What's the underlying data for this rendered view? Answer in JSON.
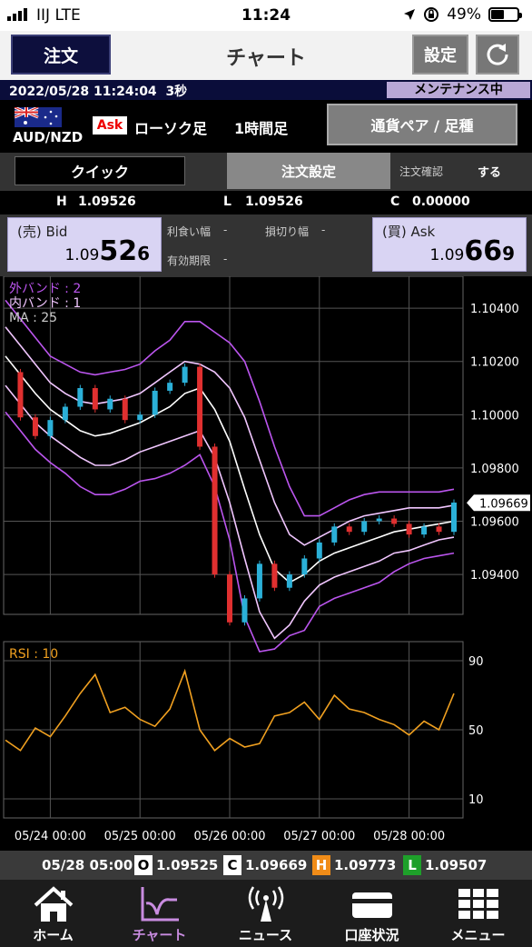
{
  "status_bar": {
    "carrier": "IIJ  LTE",
    "time": "11:24",
    "battery": "49%",
    "battery_level": 0.49,
    "icons": [
      "signal-bars-icon",
      "location-arrow-icon",
      "rotation-lock-icon",
      "battery-icon"
    ]
  },
  "header": {
    "order_button": "注文",
    "title": "チャート",
    "settings_button": "設定",
    "refresh_icon": "refresh-icon"
  },
  "info_bar": {
    "datetime": "2022/05/28 11:24:04",
    "interval": "3秒",
    "maintenance": "メンテナンス中"
  },
  "pair": {
    "name": "AUD/NZD",
    "flag_icon": "australia-flag-icon",
    "side": "Ask",
    "candle_type": "ローソク足",
    "timeframe": "1時間足",
    "pair_button": "通貨ペア / 足種"
  },
  "order_row": {
    "quick_button": "クイック",
    "order_settings": "注文設定",
    "confirm_label": "注文確認",
    "confirm_value": "する"
  },
  "hlc": {
    "h_label": "H",
    "h_value": "1.09526",
    "l_label": "L",
    "l_value": "1.09526",
    "c_label": "C",
    "c_value": "0.00000"
  },
  "bid": {
    "label": "(売) Bid",
    "prefix": "1.09",
    "big": "52",
    "tail": "6"
  },
  "ask": {
    "label": "(買) Ask",
    "prefix": "1.09",
    "big": "66",
    "tail": "9"
  },
  "order_fields": {
    "take_profit_label": "利食い幅",
    "take_profit_value": "-",
    "stop_loss_label": "損切り幅",
    "stop_loss_value": "-",
    "expiry_label": "有効期限",
    "expiry_value": "-"
  },
  "chart_data": [
    {
      "type": "line",
      "subtype": "candlestick",
      "pair": "AUD/NZD",
      "timeframe": "1時間足",
      "indicator_labels": [
        "外バンド : 2",
        "内バンド : 1",
        "MA : 25"
      ],
      "y_ticks": [
        "1.10400",
        "1.10200",
        "1.10000",
        "1.09800",
        "1.09600",
        "1.09400"
      ],
      "ylim": [
        1.0925,
        1.1052
      ],
      "current_price_label": "1.09669",
      "current_price": 1.09669,
      "x_ticks": [
        "05/24 00:00",
        "05/25 00:00",
        "05/26 00:00",
        "05/27 00:00",
        "05/28 00:00"
      ],
      "grid": true,
      "x": [
        0,
        4,
        8,
        12,
        16,
        20,
        24,
        28,
        32,
        36,
        40,
        44,
        48,
        52,
        56,
        60,
        64,
        68,
        72,
        76,
        80,
        84,
        88,
        92,
        96,
        100,
        104,
        108,
        112,
        116,
        120
      ],
      "series": [
        {
          "name": "MA : 25",
          "values": [
            1.1022,
            1.1015,
            1.1008,
            1.1002,
            1.0998,
            1.0994,
            1.0992,
            1.0993,
            1.0995,
            1.0997,
            1.1,
            1.1003,
            1.1008,
            1.101,
            1.1002,
            1.099,
            1.0972,
            1.0955,
            1.0942,
            1.0937,
            1.094,
            1.0945,
            1.0948,
            1.095,
            1.0952,
            1.0954,
            1.0956,
            1.0957,
            1.0958,
            1.0959,
            1.096
          ]
        },
        {
          "name": "内バンド : 1 (upper)",
          "values": [
            1.1033,
            1.1026,
            1.1019,
            1.1012,
            1.1008,
            1.1005,
            1.1004,
            1.1005,
            1.1006,
            1.1008,
            1.1012,
            1.1016,
            1.102,
            1.1019,
            1.1016,
            1.101,
            1.0999,
            1.0983,
            1.0967,
            1.0955,
            1.0951,
            1.0954,
            1.0957,
            1.096,
            1.0962,
            1.0963,
            1.0964,
            1.0965,
            1.0965,
            1.0965,
            1.0966
          ]
        },
        {
          "name": "内バンド : 1 (lower)",
          "values": [
            1.1011,
            1.1004,
            1.0997,
            1.0992,
            1.0988,
            1.0984,
            1.0981,
            1.0981,
            1.0983,
            1.0986,
            1.0988,
            1.099,
            1.0992,
            1.0994,
            1.0984,
            1.0967,
            1.0946,
            1.0926,
            1.0916,
            1.0921,
            1.093,
            1.0936,
            1.0939,
            1.0941,
            1.0943,
            1.0945,
            1.0948,
            1.0949,
            1.0951,
            1.0953,
            1.0954
          ]
        },
        {
          "name": "外バンド : 2 (upper)",
          "values": [
            1.1043,
            1.1036,
            1.1029,
            1.1022,
            1.1019,
            1.1016,
            1.1015,
            1.1016,
            1.1017,
            1.1019,
            1.1024,
            1.1028,
            1.1035,
            1.1035,
            1.1031,
            1.1027,
            1.102,
            1.1005,
            1.0988,
            1.0973,
            1.0962,
            1.0962,
            1.0965,
            1.0968,
            1.097,
            1.0971,
            1.0971,
            1.0971,
            1.0971,
            1.0971,
            1.0972
          ]
        },
        {
          "name": "外バンド : 2 (lower)",
          "values": [
            1.1001,
            1.0994,
            1.0987,
            1.0982,
            1.0978,
            1.0973,
            1.097,
            1.097,
            1.0972,
            1.0975,
            1.0976,
            1.0978,
            1.0981,
            1.0985,
            1.0973,
            1.0953,
            1.0924,
            1.0911,
            1.0912,
            1.0917,
            1.0919,
            1.0928,
            1.0931,
            1.0933,
            1.0935,
            1.0937,
            1.0941,
            1.0944,
            1.0946,
            1.0947,
            1.0948
          ]
        },
        {
          "name": "close",
          "values": [
            1.1016,
            1.0999,
            1.0992,
            1.0998,
            1.1003,
            1.101,
            1.1002,
            1.1006,
            1.0998,
            1.1,
            1.1009,
            1.1012,
            1.1018,
            1.0988,
            1.094,
            1.0922,
            1.0931,
            1.0944,
            1.0935,
            1.094,
            1.0946,
            1.0952,
            1.0958,
            1.0956,
            1.096,
            1.0961,
            1.0959,
            1.0955,
            1.0958,
            1.0956,
            1.0967
          ]
        }
      ]
    },
    {
      "type": "line",
      "title": "RSI : 10",
      "y_ticks": [
        "90",
        "50",
        "10"
      ],
      "ylim": [
        0,
        100
      ],
      "x": [
        0,
        4,
        8,
        12,
        16,
        20,
        24,
        28,
        32,
        36,
        40,
        44,
        48,
        52,
        56,
        60,
        64,
        68,
        72,
        76,
        80,
        84,
        88,
        92,
        96,
        100,
        104,
        108,
        112,
        116,
        120
      ],
      "series": [
        {
          "name": "RSI : 10",
          "values": [
            44,
            38,
            51,
            46,
            58,
            71,
            82,
            60,
            63,
            56,
            52,
            62,
            84,
            50,
            38,
            45,
            40,
            42,
            58,
            60,
            66,
            56,
            70,
            62,
            60,
            56,
            53,
            47,
            55,
            50,
            71
          ]
        }
      ]
    }
  ],
  "ohlc_bar": {
    "time": "05/28 05:00",
    "o_label": "O",
    "o_value": "1.09525",
    "c_label": "C",
    "c_value": "1.09669",
    "h_label": "H",
    "h_value": "1.09773",
    "l_label": "L",
    "l_value": "1.09507"
  },
  "tabs": [
    {
      "label": "ホーム",
      "icon": "home-icon"
    },
    {
      "label": "チャート",
      "icon": "chart-icon",
      "active": true
    },
    {
      "label": "ニュース",
      "icon": "broadcast-icon"
    },
    {
      "label": "口座状況",
      "icon": "account-icon"
    },
    {
      "label": "メニュー",
      "icon": "menu-grid-icon"
    }
  ],
  "colors": {
    "accent_navy": "#0d0f3d",
    "candle_up": "#2bb0d8",
    "candle_down": "#e03030",
    "ma_line": "#ffffff",
    "inner_band": "#f1c6ff",
    "outer_band": "#bb55ee",
    "rsi_line": "#f0a020",
    "active_tab": "#c98ce0"
  }
}
